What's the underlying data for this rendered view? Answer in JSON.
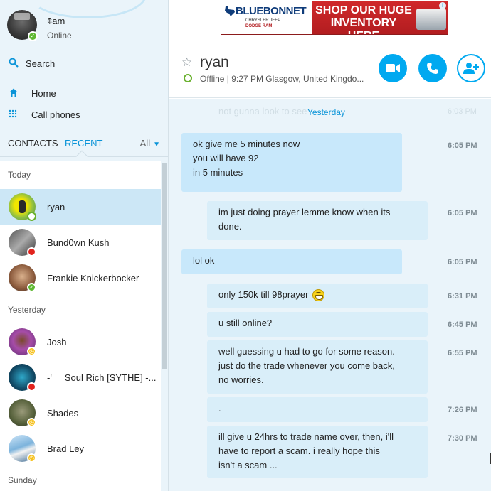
{
  "colors": {
    "accent": "#00a9f0",
    "online": "#5fb832",
    "dnd": "#e1231d",
    "away": "#f6c11c",
    "sidebar_bg": "#eaf4fa",
    "selected_row": "#cce7f6"
  },
  "ad": {
    "brand": "BLUEBONNET",
    "makes_line1": "CHRYSLER JEEP",
    "makes_line2": "DODGE  RAM",
    "headline": "SHOP OUR HUGE INVENTORY HERE",
    "info_icon": "i"
  },
  "profile": {
    "name": "¢am",
    "status": "Online"
  },
  "sidebar": {
    "search_label": "Search",
    "nav": [
      {
        "label": "Home",
        "icon": "home-icon"
      },
      {
        "label": "Call phones",
        "icon": "dialpad-icon"
      }
    ],
    "tabs": {
      "contacts": "CONTACTS",
      "recent": "RECENT",
      "filter": "All"
    }
  },
  "recent": {
    "today_label": "Today",
    "yesterday_label": "Yesterday",
    "sunday_label": "Sunday",
    "contacts": [
      {
        "name": "ryan",
        "status": "offline"
      },
      {
        "name": "Bund0wn Kush",
        "status": "dnd"
      },
      {
        "name": "Frankie Knickerbocker",
        "status": "online"
      },
      {
        "name": "Josh",
        "status": "away"
      },
      {
        "name": "-'     Soul Rich [SYTHE] -...",
        "status": "dnd"
      },
      {
        "name": "Shades",
        "status": "away"
      },
      {
        "name": "Brad Ley",
        "status": "away"
      }
    ]
  },
  "chat": {
    "title": "ryan",
    "presence": "Offline | 9:27 PM Glasgow, United Kingdo...",
    "date_separator": "Yesterday",
    "ghost_message": "not gunna look to see",
    "ghost_time": "6:03 PM",
    "messages": [
      {
        "direction": "in",
        "lines": [
          "ok give me 5 minutes now",
          "you will have 92",
          "in 5 minutes"
        ],
        "time": "6:05 PM"
      },
      {
        "direction": "out",
        "lines": [
          "im just doing prayer lemme know when its",
          "done."
        ],
        "time": "6:05 PM"
      },
      {
        "direction": "in",
        "lines": [
          "lol ok"
        ],
        "time": "6:05 PM"
      },
      {
        "direction": "out",
        "lines": [
          "only 150k till 98prayer"
        ],
        "emoji": "grin",
        "time": "6:31 PM"
      },
      {
        "direction": "out",
        "lines": [
          "u still online?"
        ],
        "time": "6:45 PM"
      },
      {
        "direction": "out",
        "lines": [
          "well guessing u had to go for some reason.",
          "just do the trade whenever you come back,",
          "no worries."
        ],
        "time": "6:55 PM"
      },
      {
        "direction": "out",
        "lines": [
          "."
        ],
        "time": "7:26 PM"
      },
      {
        "direction": "out",
        "lines": [
          "ill give u 24hrs to trade name over, then, i'll",
          "have to report a scam. i really hope this",
          "isn't a scam ..."
        ],
        "time": "7:30 PM"
      }
    ]
  }
}
